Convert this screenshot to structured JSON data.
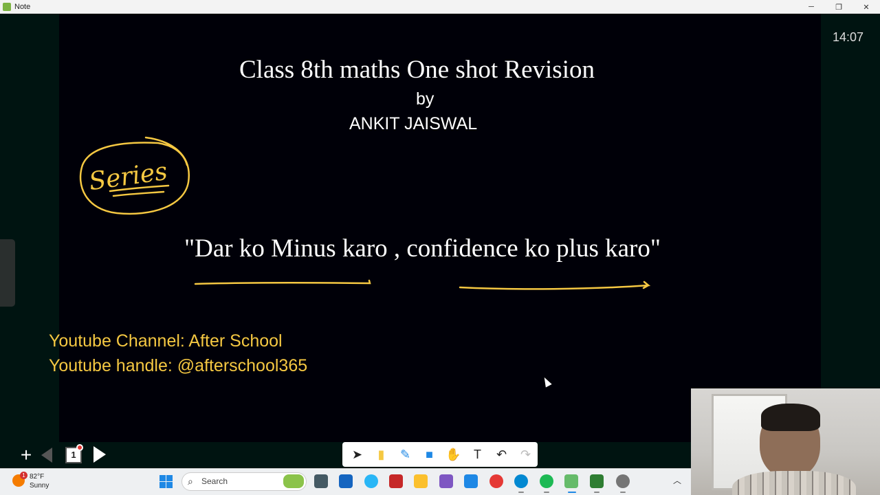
{
  "window": {
    "title": "Note",
    "controls": {
      "minimize": "─",
      "restore": "❐",
      "close": "✕"
    }
  },
  "clock": "14:07",
  "slide": {
    "title": "Class 8th maths One shot Revision",
    "by": "by",
    "author": "ANKIT JAISWAL",
    "handwriting": "Series",
    "quote": "\"Dar ko Minus karo , confidence ko plus karo\"",
    "channel_line": "Youtube Channel: After School",
    "handle_line": "Youtube handle: @afterschool365",
    "ink_color": "#f5c842"
  },
  "page_nav": {
    "add": "+",
    "page_number": "1"
  },
  "tools": [
    {
      "name": "select-tool",
      "glyph": "➤"
    },
    {
      "name": "highlighter-tool",
      "glyph": "▮"
    },
    {
      "name": "pen-tool",
      "glyph": "✎"
    },
    {
      "name": "shape-tool",
      "glyph": "■"
    },
    {
      "name": "hand-tool",
      "glyph": "✋"
    },
    {
      "name": "text-tool",
      "glyph": "T"
    },
    {
      "name": "undo-tool",
      "glyph": "↶"
    },
    {
      "name": "redo-tool",
      "glyph": "↷"
    }
  ],
  "taskbar": {
    "temperature": "82°F",
    "condition": "Sunny",
    "weather_badge": "1",
    "search_placeholder": "Search"
  },
  "colors": {
    "canvas": "#000008",
    "ink": "#f5c842",
    "workspace": "#001411"
  }
}
